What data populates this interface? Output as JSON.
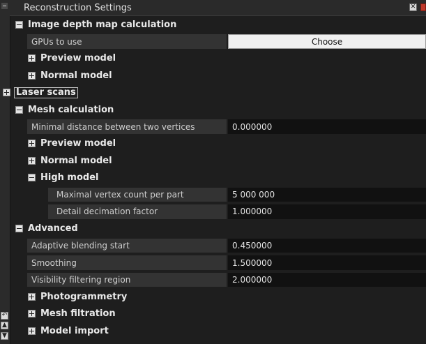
{
  "panel": {
    "title": "Reconstruction Settings"
  },
  "sections": {
    "depth": {
      "label": "Image depth map calculation",
      "gpus_label": "GPUs to use",
      "gpus_button": "Choose",
      "preview": "Preview model",
      "normal": "Normal model"
    },
    "laser": {
      "label": "Laser scans"
    },
    "mesh": {
      "label": "Mesh calculation",
      "min_dist_label": "Minimal distance between two vertices",
      "min_dist_value": "0.000000",
      "preview": "Preview model",
      "normal": "Normal model",
      "high": {
        "label": "High model",
        "max_vertex_label": "Maximal vertex count per part",
        "max_vertex_value": "5 000 000",
        "decimation_label": "Detail decimation factor",
        "decimation_value": "1.000000"
      }
    },
    "advanced": {
      "label": "Advanced",
      "adaptive_label": "Adaptive blending start",
      "adaptive_value": "0.450000",
      "smoothing_label": "Smoothing",
      "smoothing_value": "1.500000",
      "visibility_label": "Visibility filtering region",
      "visibility_value": "2.000000",
      "photogrammetry": "Photogrammetry",
      "mesh_filtration": "Mesh filtration",
      "model_import": "Model import"
    }
  },
  "icons": {
    "gutter": [
      "undo-icon",
      "move-up-icon",
      "move-down-icon"
    ]
  }
}
